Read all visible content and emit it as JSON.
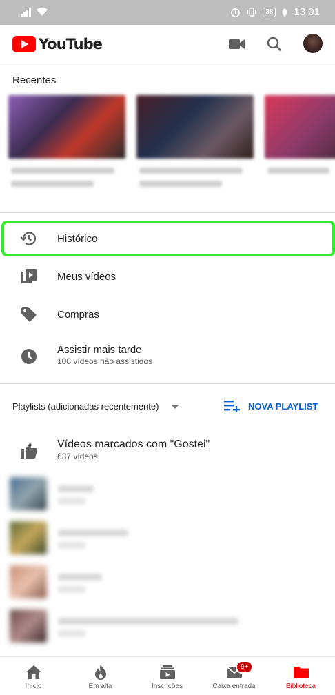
{
  "status_bar": {
    "battery": "38",
    "time": "13:01"
  },
  "header": {
    "logo_text": "YouTube"
  },
  "recents": {
    "label": "Recentes"
  },
  "menu": [
    {
      "label": "Histórico",
      "icon": "history-icon"
    },
    {
      "label": "Meus vídeos",
      "icon": "my-videos-icon"
    },
    {
      "label": "Compras",
      "icon": "purchases-tag-icon"
    },
    {
      "label": "Assistir mais tarde",
      "subtitle": "108 vídeos não assistidos",
      "icon": "watch-later-clock-icon"
    }
  ],
  "playlists": {
    "label": "Playlists (adicionadas recentemente)",
    "new_playlist": "NOVA PLAYLIST",
    "liked": {
      "title": "Vídeos marcados com \"Gostei\"",
      "subtitle": "637 vídeos"
    }
  },
  "bottom_nav": [
    {
      "label": "Início",
      "icon": "home-icon",
      "active": false
    },
    {
      "label": "Em alta",
      "icon": "trending-fire-icon",
      "active": false
    },
    {
      "label": "Inscrições",
      "icon": "subscriptions-icon",
      "active": false
    },
    {
      "label": "Caixa entrada",
      "icon": "inbox-mail-icon",
      "active": false,
      "badge": "9+"
    },
    {
      "label": "Biblioteca",
      "icon": "library-folder-icon",
      "active": true
    }
  ],
  "colors": {
    "brand_red": "#ff0000",
    "active_red": "#cc0000",
    "link_blue": "#065fd4",
    "highlight_green": "#2bef2b"
  }
}
